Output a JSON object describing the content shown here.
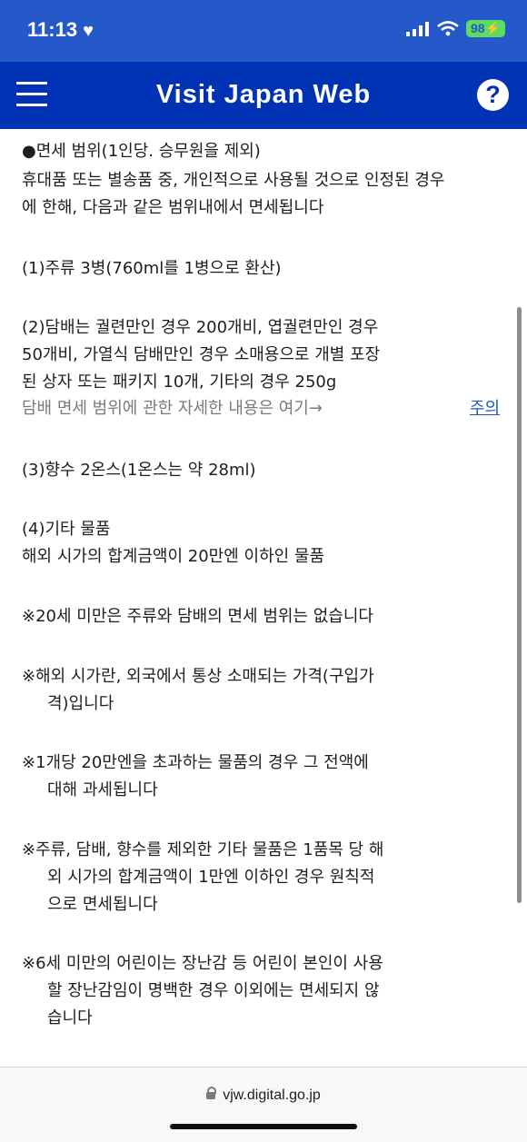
{
  "status_bar": {
    "time": "11:13",
    "battery": "98"
  },
  "header": {
    "title": "Visit Japan Web",
    "help_label": "?"
  },
  "content": {
    "lines": [
      "●면세 범위(1인당. 승무원을 제외)",
      "휴대품 또는 별송품 중, 개인적으로 사용될 것으로 인정된 경우",
      "에 한해, 다음과 같은 범위내에서 면세됩니다",
      "(1)주류 3병(760ml를 1병으로 환산)",
      "(2)담배는 궐련만인 경우 200개비, 엽궐련만인 경우",
      "50개비, 가열식 담배만인 경우 소매용으로 개별 포장",
      "된 상자 또는 패키지 10개, 기타의 경우 250g",
      "담배 면세 범위에 관한 자세한 내용은 여기→",
      "(3)향수 2온스(1온스는 약 28ml)",
      "(4)기타 물품",
      "해외 시가의 합계금액이 20만엔 이하인 물품",
      "※20세 미만은 주류와 담배의 면세 범위는 없습니다",
      "※해외 시가란, 외국에서 통상 소매되는 가격(구입가",
      "격)입니다",
      "※1개당 20만엔을 초과하는 물품의 경우 그 전액에",
      "대해 과세됩니다",
      "※주류, 담배, 향수를 제외한 기타 물품은 1품목 당 해",
      "외 시가의 합계금액이 1만엔 이하인 경우 원칙적",
      "으로 면세됩니다",
      "※6세 미만의 어린이는 장난감 등 어린이 본인이 사용",
      "할 장난감임이 명백한 경우 이외에는 면세되지 않",
      "습니다"
    ],
    "note_link": "주의"
  },
  "bottom_bar": {
    "url": "vjw.digital.go.jp"
  },
  "colors": {
    "header": "#0033b3",
    "status_bar": "#2558c9",
    "link": "#1a56c4"
  }
}
